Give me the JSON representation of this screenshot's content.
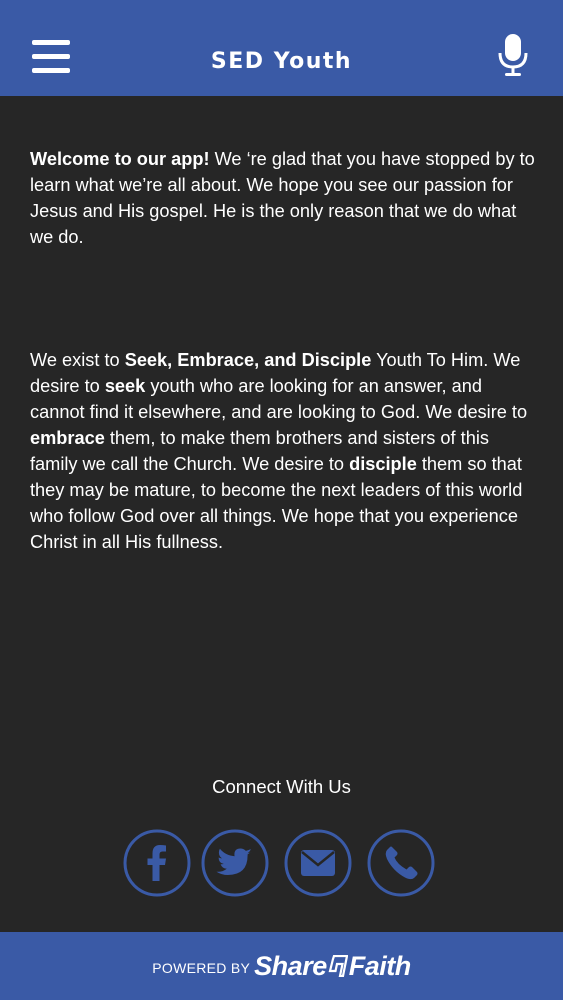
{
  "header": {
    "title": "SED Youth",
    "menu_icon": "hamburger-menu-icon",
    "mic_icon": "microphone-icon"
  },
  "content": {
    "p1_bold": "Welcome to our app!",
    "p1_text": " We ‘re glad that you have stopped by to learn what we’re all about. We hope you see our passion for Jesus and His gospel. He is the only reason that we do what we do.",
    "p2_a": "We exist to ",
    "p2_b": "Seek, Embrace, and Disciple",
    "p2_c": " Youth To Him. We desire to ",
    "p2_d": "seek",
    "p2_e": " youth who are looking for an answer, and cannot find it elsewhere, and are looking to God. We desire to ",
    "p2_f": "embrace",
    "p2_g": " them, to make them brothers and sisters of this family we call the Church. We desire to ",
    "p2_h": "disciple",
    "p2_i": " them so that they may be mature, to become the next leaders of this world who follow God over all things. We hope that you experience Christ in all His fullness."
  },
  "connect": {
    "label": "Connect With Us",
    "icons": [
      "facebook-icon",
      "twitter-icon",
      "email-icon",
      "phone-icon"
    ]
  },
  "footer": {
    "powered_by": "POWERED BY",
    "brand_left": "Share",
    "brand_right": "Faith"
  },
  "colors": {
    "header_bg": "#3a5aa6",
    "body_bg": "#262626",
    "icon_blue": "#3a5aa6",
    "text": "#ffffff"
  }
}
